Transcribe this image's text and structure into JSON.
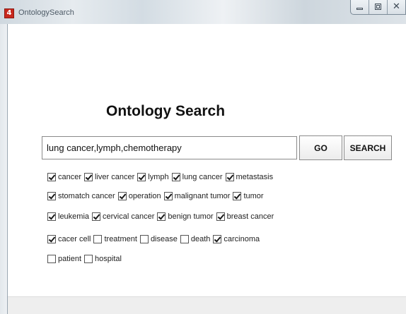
{
  "window": {
    "icon_text": "4",
    "title": "OntologySearch",
    "controls": {
      "minimize_icon": "minimize-icon",
      "maximize_icon": "maximize-icon",
      "close_icon": "close-icon",
      "close_glyph": "✕"
    }
  },
  "main": {
    "heading": "Ontology Search",
    "search": {
      "value": "lung cancer,lymph,chemotherapy",
      "placeholder": ""
    },
    "go_label": "GO",
    "search_label": "SEARCH",
    "checkbox_rows": [
      [
        {
          "label": "cancer",
          "checked": true
        },
        {
          "label": "liver cancer",
          "checked": true
        },
        {
          "label": "lymph",
          "checked": true
        },
        {
          "label": "lung cancer",
          "checked": true
        },
        {
          "label": "metastasis",
          "checked": true
        }
      ],
      [
        {
          "label": "stomatch cancer",
          "checked": true
        },
        {
          "label": "operation",
          "checked": true
        },
        {
          "label": "malignant tumor",
          "checked": true
        },
        {
          "label": "tumor",
          "checked": true
        }
      ],
      [
        {
          "label": "leukemia",
          "checked": true
        },
        {
          "label": "cervical cancer",
          "checked": true
        },
        {
          "label": "benign tumor",
          "checked": true
        },
        {
          "label": "breast cancer",
          "checked": true
        }
      ],
      [
        {
          "label": "cacer cell",
          "checked": true
        },
        {
          "label": "treatment",
          "checked": false
        },
        {
          "label": "disease",
          "checked": false
        },
        {
          "label": "death",
          "checked": false
        },
        {
          "label": "carcinoma",
          "checked": true
        }
      ],
      [
        {
          "label": "patient",
          "checked": false
        },
        {
          "label": "hospital",
          "checked": false
        }
      ]
    ]
  },
  "colors": {
    "app_icon": "#c8281e",
    "title_text": "#4d5a66"
  }
}
